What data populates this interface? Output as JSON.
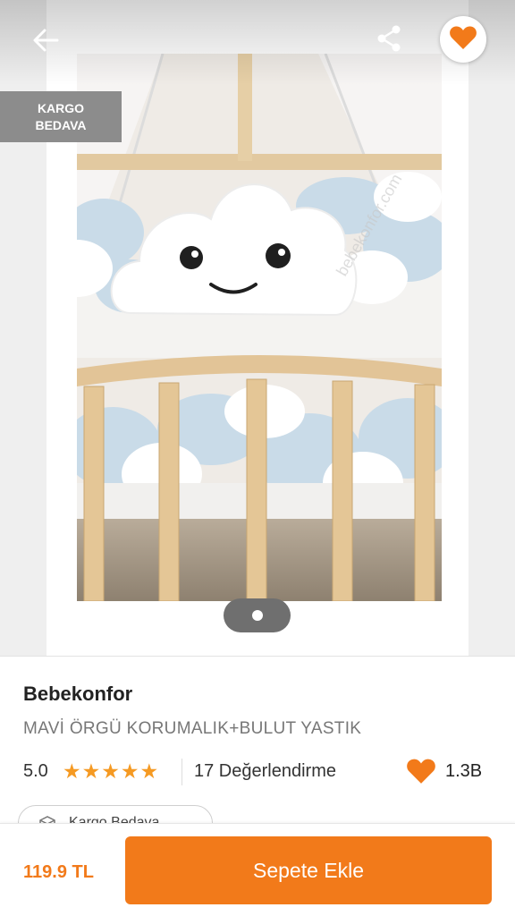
{
  "header": {
    "back_icon": "arrow-left-icon",
    "share_icon": "share-icon",
    "favorite_icon": "heart-icon"
  },
  "gallery": {
    "badge_line1": "KARGO",
    "badge_line2": "BEDAVA",
    "current_page": 1,
    "total_pages": 1,
    "watermark": "bebekonfor.com"
  },
  "product": {
    "brand": "Bebekonfor",
    "name": "MAVİ ÖRGÜ KORUMALIK+BULUT YASTIK",
    "rating": "5.0",
    "star_count": 5,
    "reviews": "17 Değerlendirme",
    "favorites": "1.3B",
    "chip_label": "Kargo Bedava"
  },
  "footer": {
    "price": "119.9 TL",
    "cta": "Sepete Ekle"
  },
  "colors": {
    "accent": "#f27a1a",
    "star": "#f59a23",
    "badge": "#8c8c8c"
  }
}
